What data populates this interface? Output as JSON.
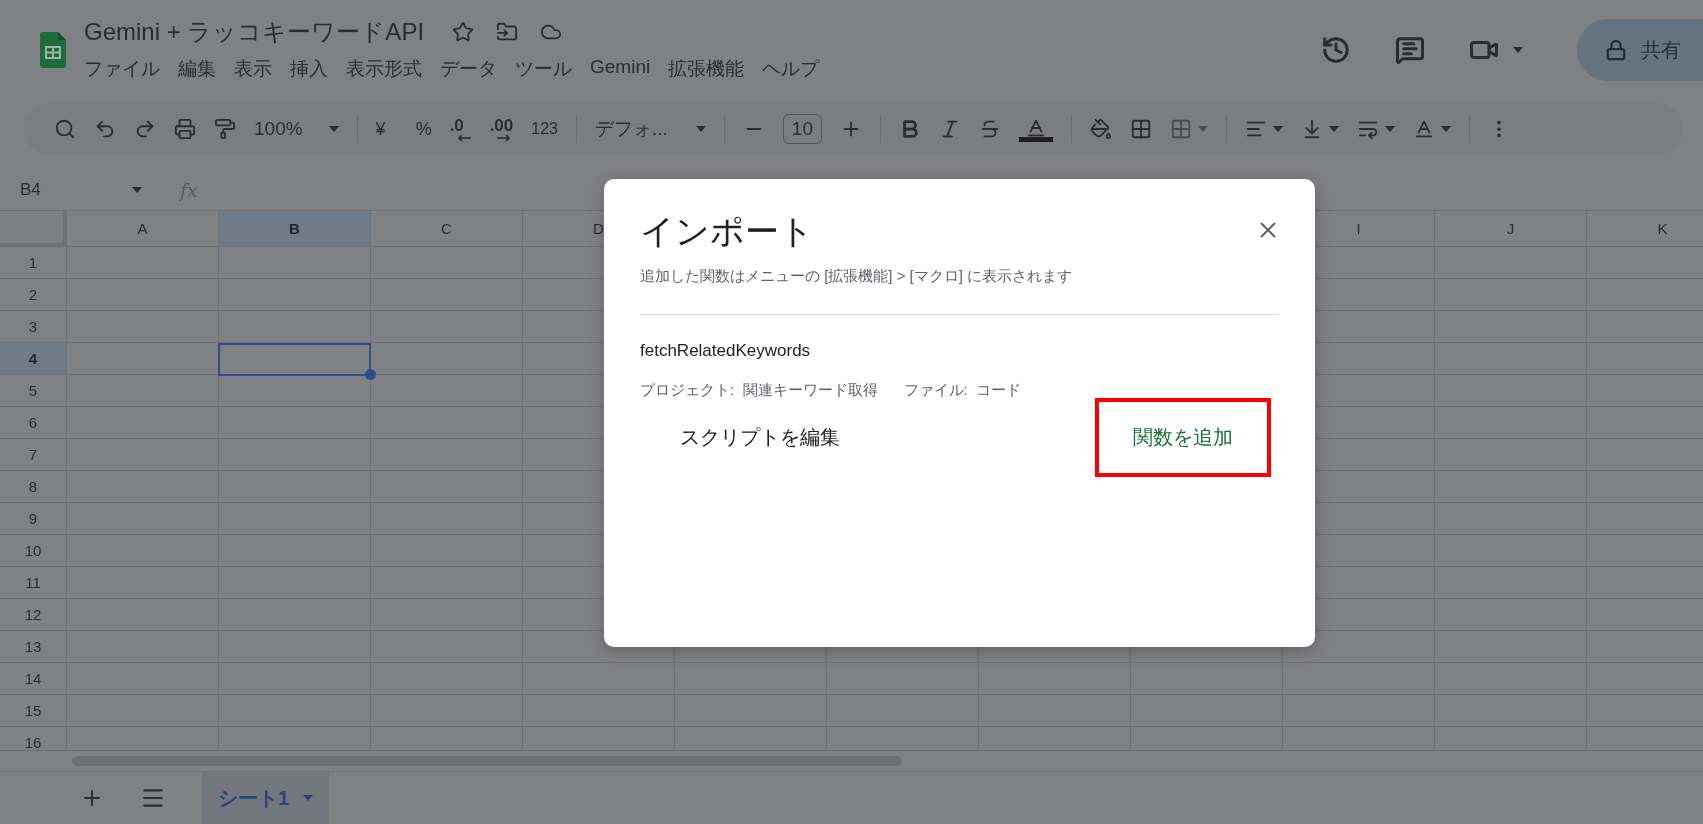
{
  "document": {
    "title": "Gemini + ラッコキーワードAPI"
  },
  "menu": [
    "ファイル",
    "編集",
    "表示",
    "挿入",
    "表示形式",
    "データ",
    "ツール",
    "Gemini",
    "拡張機能",
    "ヘルプ"
  ],
  "share_button": {
    "label": "共有"
  },
  "toolbar": {
    "zoom": "100%",
    "currency": "¥",
    "percent": "%",
    "decrease_decimals": ".0",
    "increase_decimals": ".00",
    "number_format": "123",
    "font": "デフォ...",
    "font_size": "10"
  },
  "formula_bar": {
    "cell_ref": "B4",
    "formula_label": "fx"
  },
  "grid": {
    "columns": [
      {
        "label": "A",
        "selected": false
      },
      {
        "label": "B",
        "selected": true
      },
      {
        "label": "C",
        "selected": false
      },
      {
        "label": "D",
        "selected": false
      }
    ],
    "columns_right": [
      {
        "label": "I",
        "selected": false
      },
      {
        "label": "J",
        "selected": false
      },
      {
        "label": "K",
        "selected": false
      }
    ],
    "rows": [
      {
        "label": "1",
        "selected": false
      },
      {
        "label": "2",
        "selected": false
      },
      {
        "label": "3",
        "selected": false
      },
      {
        "label": "4",
        "selected": true
      },
      {
        "label": "5",
        "selected": false
      },
      {
        "label": "6",
        "selected": false
      },
      {
        "label": "7",
        "selected": false
      },
      {
        "label": "8",
        "selected": false
      },
      {
        "label": "9",
        "selected": false
      },
      {
        "label": "10",
        "selected": false
      },
      {
        "label": "11",
        "selected": false
      },
      {
        "label": "12",
        "selected": false
      },
      {
        "label": "13",
        "selected": false
      },
      {
        "label": "14",
        "selected": false
      },
      {
        "label": "15",
        "selected": false
      },
      {
        "label": "16",
        "selected": false
      }
    ]
  },
  "sheet_tabs": [
    {
      "label": "シート1",
      "selected": true
    }
  ],
  "dialog": {
    "title": "インポート",
    "subtitle": "追加した関数はメニューの [拡張機能] > [マクロ] に表示されます",
    "function_name": "fetchRelatedKeywords",
    "project_label": "プロジェクト:",
    "project": "関連キーワード取得",
    "file_label": "ファイル:",
    "file": "コード",
    "buttons": [
      {
        "label": "スクリプトを編集",
        "kind": "text",
        "highlighted": false
      },
      {
        "label": "関数を追加",
        "kind": "primary",
        "highlighted": true
      }
    ]
  }
}
